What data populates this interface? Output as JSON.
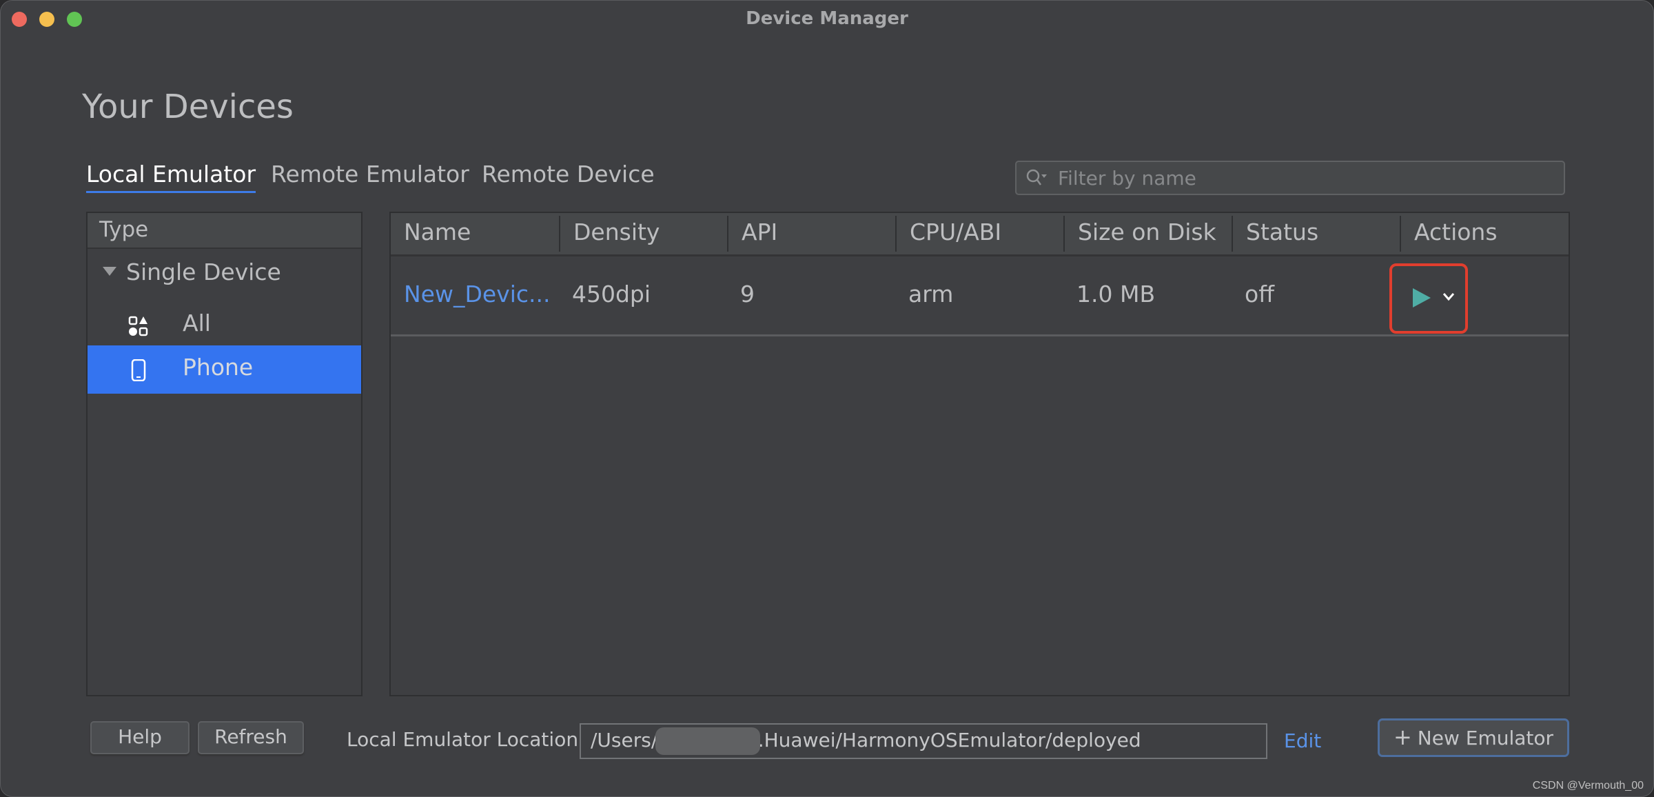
{
  "window": {
    "title": "Device Manager",
    "controls": [
      "close",
      "minimize",
      "maximize"
    ]
  },
  "page_title": "Your Devices",
  "tabs": [
    {
      "label": "Local Emulator",
      "active": true
    },
    {
      "label": "Remote Emulator",
      "active": false
    },
    {
      "label": "Remote Device",
      "active": false
    }
  ],
  "search": {
    "placeholder": "Filter by name",
    "value": "",
    "icon": "search-icon"
  },
  "sidebar": {
    "header": "Type",
    "group": {
      "label": "Single Device",
      "expanded": true
    },
    "items": [
      {
        "label": "All",
        "icon": "all-devices-icon",
        "selected": false
      },
      {
        "label": "Phone",
        "icon": "phone-icon",
        "selected": true
      }
    ]
  },
  "table": {
    "columns": [
      "Name",
      "Density",
      "API",
      "CPU/ABI",
      "Size on Disk",
      "Status",
      "Actions"
    ],
    "rows": [
      {
        "name": "New_Devic...",
        "density": "450dpi",
        "api": "9",
        "cpu_abi": "arm",
        "size": "1.0 MB",
        "status": "off",
        "actions": [
          "play-icon",
          "chevron-down-icon"
        ]
      }
    ]
  },
  "footer": {
    "help_label": "Help",
    "refresh_label": "Refresh",
    "location_label": "Local Emulator Location:",
    "location_prefix": "/Users/",
    "location_suffix": "/.Huawei/HarmonyOSEmulator/deployed",
    "edit_label": "Edit",
    "new_emulator_label": "New Emulator"
  },
  "watermark": "CSDN @Vermouth_00",
  "colors": {
    "accent": "#3474f0",
    "link": "#5a93e8",
    "play": "#4fada5",
    "highlight_box": "#e13e2e",
    "background": "#3e3f42"
  }
}
